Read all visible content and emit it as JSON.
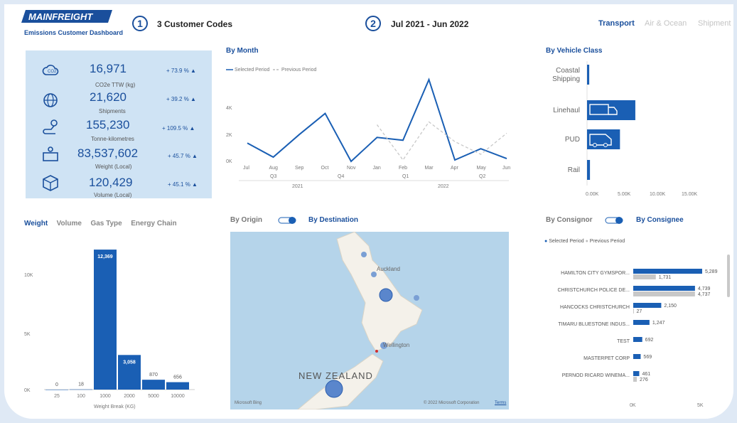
{
  "header": {
    "logo_text": "MAINFREIGHT",
    "dashboard_title": "Emissions Customer Dashboard",
    "step1_num": "1",
    "customer_codes": "3 Customer Codes",
    "step2_num": "2",
    "date_range": "Jul 2021 - Jun 2022",
    "tabs": [
      "Transport",
      "Air & Ocean",
      "Shipment"
    ]
  },
  "kpis": [
    {
      "icon": "co2-cloud-icon",
      "value": "16,971",
      "label": "CO2e TTW (kg)",
      "change": "+ 73.9 % ▲"
    },
    {
      "icon": "globe-icon",
      "value": "21,620",
      "label": "Shipments",
      "change": "+ 39.2 % ▲"
    },
    {
      "icon": "route-pin-icon",
      "value": "155,230",
      "label": "Tonne-kilometres",
      "change": "+ 109.5 % ▲"
    },
    {
      "icon": "scale-icon",
      "value": "83,537,602",
      "label": "Weight (Local)",
      "change": "+ 45.7 % ▲"
    },
    {
      "icon": "package-box-icon",
      "value": "120,429",
      "label": "Volume (Local)",
      "change": "+ 45.1 % ▲"
    }
  ],
  "by_month": {
    "title": "By Month",
    "legend_selected": "Selected Period",
    "legend_previous": "Previous Period",
    "y_ticks": [
      "4K",
      "2K",
      "0K"
    ],
    "months": [
      "Jul",
      "Aug",
      "Sep",
      "Oct",
      "Nov",
      "Jan",
      "Feb",
      "Mar",
      "Apr",
      "May",
      "Jun"
    ],
    "quarters": [
      "Q3",
      "Q4",
      "Q1",
      "Q2"
    ],
    "years": [
      "2021",
      "2022"
    ]
  },
  "by_vehicle": {
    "title": "By Vehicle Class",
    "classes": [
      "Coastal Shipping",
      "Linehaul",
      "PUD",
      "Rail"
    ],
    "x_ticks": [
      "0.00K",
      "5.00K",
      "10.00K",
      "15.00K"
    ]
  },
  "weight_panel": {
    "tabs": [
      "Weight",
      "Volume",
      "Gas Type",
      "Energy Chain"
    ],
    "y_ticks": [
      "10K",
      "5K",
      "0K"
    ],
    "xlabel": "Weight Break (KG)"
  },
  "map_panel": {
    "origin_label": "By Origin",
    "destination_label": "By Destination",
    "country": "NEW ZEALAND",
    "city1": "Auckland",
    "city2": "Wellington",
    "provider": "Microsoft Bing",
    "copyright": "© 2022 Microsoft Corporation",
    "terms": "Terms"
  },
  "consignee_panel": {
    "consignor_label": "By Consignor",
    "consignee_label": "By Consignee",
    "legend_selected": "Selected Period",
    "legend_previous": "Previous Period",
    "x_ticks": [
      "0K",
      "5K"
    ]
  },
  "chart_data": [
    {
      "type": "line",
      "x": [
        "Jul",
        "Aug",
        "Sep",
        "Oct",
        "Nov",
        "Jan",
        "Feb",
        "Mar",
        "Apr",
        "May",
        "Jun"
      ],
      "series": [
        {
          "name": "Selected Period",
          "values": [
            1300,
            300,
            1900,
            3400,
            0,
            1700,
            1500,
            5800,
            100,
            900,
            200
          ]
        },
        {
          "name": "Previous Period",
          "values": [
            null,
            null,
            null,
            null,
            null,
            2600,
            100,
            2800,
            1400,
            500,
            2000
          ]
        }
      ],
      "ylim": [
        0,
        6000
      ]
    },
    {
      "type": "bar",
      "orientation": "horizontal",
      "categories": [
        "Coastal Shipping",
        "Linehaul",
        "PUD",
        "Rail"
      ],
      "values": [
        300,
        6600,
        4500,
        400
      ],
      "xlim": [
        0,
        17000
      ]
    },
    {
      "type": "bar",
      "categories": [
        "25",
        "100",
        "1000",
        "2000",
        "5000",
        "10000"
      ],
      "values": [
        0,
        18,
        12369,
        3058,
        870,
        656
      ],
      "xlabel": "Weight Break (KG)",
      "ylim": [
        0,
        12500
      ]
    },
    {
      "type": "bar",
      "orientation": "horizontal",
      "categories": [
        "HAMILTON CITY GYMSPOR...",
        "CHRISTCHURCH POLICE DE...",
        "HANCOCKS CHRISTCHURCH",
        "TIMARU BLUESTONE INDUS...",
        "TEST",
        "MASTERPET CORP",
        "PERNOD RICARD WINEMA..."
      ],
      "series": [
        {
          "name": "Selected Period",
          "values": [
            5289,
            4739,
            2150,
            1247,
            692,
            569,
            461
          ]
        },
        {
          "name": "Previous Period",
          "values": [
            1731,
            4737,
            27,
            null,
            null,
            null,
            276
          ]
        }
      ],
      "xlim": [
        0,
        6000
      ]
    }
  ]
}
